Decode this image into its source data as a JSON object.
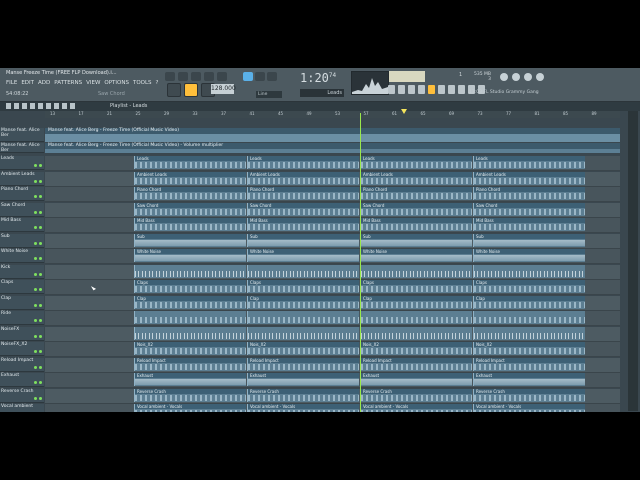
{
  "window": {
    "title": "Manse Freeze Time (FREE FLP Download).i...",
    "menu": [
      "FILE",
      "EDIT",
      "ADD",
      "PATTERNS",
      "VIEW",
      "OPTIONS",
      "TOOLS",
      "?"
    ],
    "time_small": "54:08:22",
    "hint": "Saw Chord"
  },
  "transport": {
    "tempo": "128.000",
    "big_time": "1:20",
    "big_time_sub": "74",
    "snap": "Line",
    "pattern": "Leads"
  },
  "status": {
    "voices": "1",
    "memory": "535 MB",
    "memory_sub": "3",
    "news": "13:03 FL Studio Grammy Gang"
  },
  "playlist": {
    "title": "Playlist - Leads",
    "ruler": [
      "13",
      "17",
      "21",
      "25",
      "29",
      "33",
      "37",
      "41",
      "45",
      "49",
      "53",
      "57",
      "61",
      "65",
      "69",
      "73",
      "77",
      "81",
      "85",
      "89"
    ]
  },
  "audio_tracks": [
    {
      "name": "Manse feat. Alice Ber",
      "clip": "Manse feat. Alice Berg - Freeze Time (Official Music Video)"
    },
    {
      "name": "Manse feat. Alice Ber",
      "clip": "Manse feat. Alice Berg - Freeze Time (Official Music Video) - Volume multiplier"
    }
  ],
  "tracks": [
    {
      "name": "Leads",
      "clip": "Leads"
    },
    {
      "name": "Ambient Leads",
      "clip": "Ambient Leads"
    },
    {
      "name": "Piano Chord",
      "clip": "Piano Chord"
    },
    {
      "name": "Saw Chord",
      "clip": "Saw Chord"
    },
    {
      "name": "Mid Bass",
      "clip": "Mid Bass"
    },
    {
      "name": "Sub",
      "clip": "Sub"
    },
    {
      "name": "White Noise",
      "clip": "White Noise"
    },
    {
      "name": "Kick",
      "clip": ""
    },
    {
      "name": "Claps",
      "clip": "Claps"
    },
    {
      "name": "Clap",
      "clip": "Clap"
    },
    {
      "name": "Ride",
      "clip": ""
    },
    {
      "name": "NoiseFX",
      "clip": ""
    },
    {
      "name": "NoiseFX_X2",
      "clip": "Nois_X2"
    },
    {
      "name": "Reload Impact",
      "clip": "Reload Impact"
    },
    {
      "name": "Exhaust",
      "clip": "Exhaust"
    },
    {
      "name": "Reverse Crash",
      "clip": "Reverse Crash"
    },
    {
      "name": "Vocal ambient",
      "clip": "Vocal ambient - Vocals"
    }
  ]
}
